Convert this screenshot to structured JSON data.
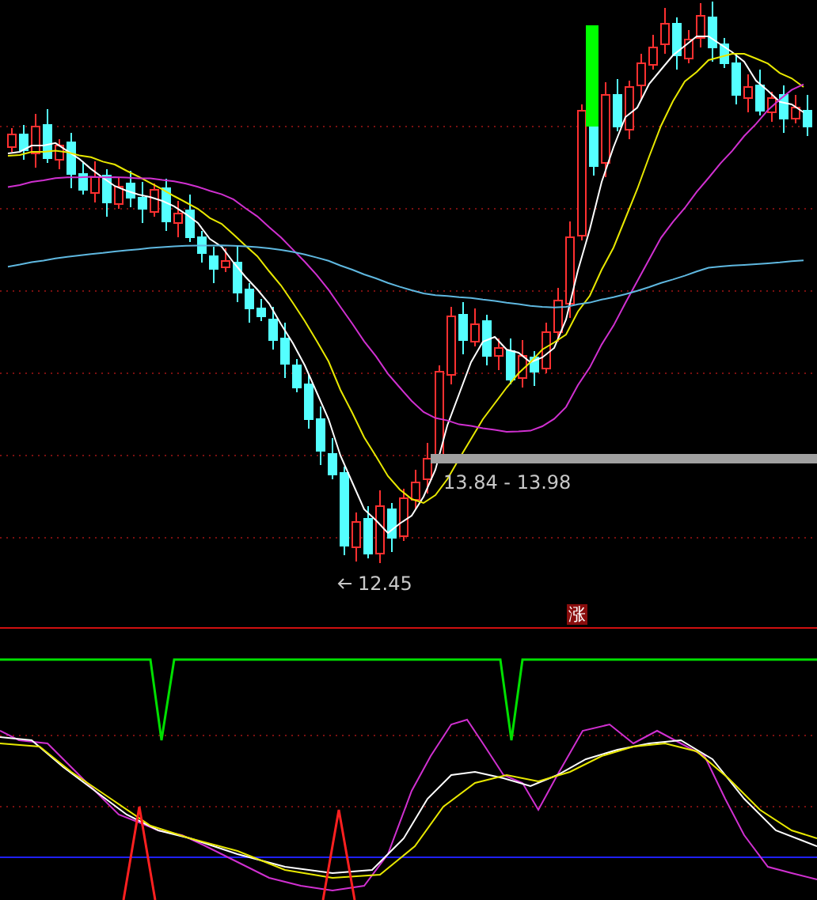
{
  "main_chart": {
    "range_label": "13.84 - 13.98",
    "low_label": "12.45"
  },
  "indicator_panel": {
    "badge": "涨"
  }
}
